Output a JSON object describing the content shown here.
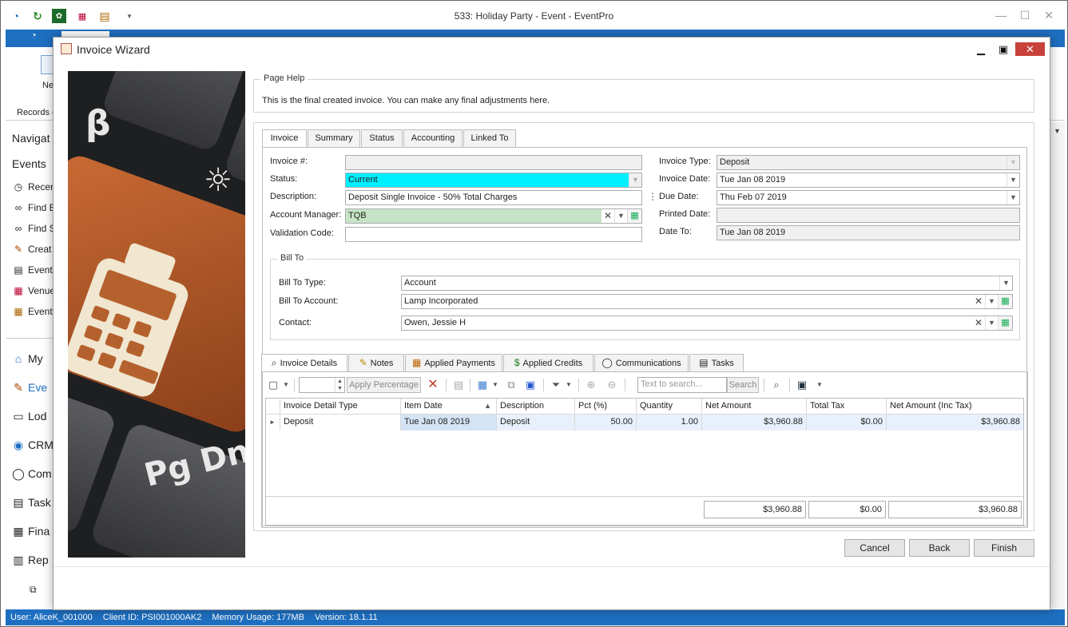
{
  "app": {
    "title": "533: Holiday Party - Event - EventPro",
    "ribbon": {
      "new_label": "Ne",
      "records_label": "Records ("
    },
    "nav": {
      "header": "Navigat",
      "events_header": "Events",
      "items": [
        "Recen",
        "Find E",
        "Find S",
        "Creat",
        "Event",
        "Venue",
        "Event"
      ],
      "modules": [
        "My",
        "Eve",
        "Lod",
        "CRM",
        "Com",
        "Task",
        "Fina",
        "Rep"
      ]
    },
    "status": {
      "user": "User: AliceK_001000",
      "client": "Client ID: PSI001000AK2",
      "memory": "Memory Usage: 177MB",
      "version": "Version: 18.1.11"
    }
  },
  "dialog": {
    "title": "Invoice Wizard",
    "page_help": {
      "legend": "Page Help",
      "text": "This is the final created invoice.  You can make any final adjustments here."
    },
    "tabs": [
      "Invoice",
      "Summary",
      "Status",
      "Accounting",
      "Linked To"
    ],
    "invoice": {
      "invoice_no_label": "Invoice #:",
      "invoice_no_value": "",
      "status_label": "Status:",
      "status_value": "Current",
      "description_label": "Description:",
      "description_value": "Deposit Single Invoice - 50% Total Charges",
      "account_manager_label": "Account Manager:",
      "account_manager_value": "TQB",
      "validation_code_label": "Validation Code:",
      "validation_code_value": "",
      "invoice_type_label": "Invoice Type:",
      "invoice_type_value": "Deposit",
      "invoice_date_label": "Invoice Date:",
      "invoice_date_value": "Tue Jan 08 2019",
      "due_date_label": "Due Date:",
      "due_date_value": "Thu Feb 07 2019",
      "printed_date_label": "Printed Date:",
      "printed_date_value": "",
      "date_to_label": "Date To:",
      "date_to_value": "Tue Jan 08 2019"
    },
    "bill_to": {
      "legend": "Bill To",
      "type_label": "Bill To Type:",
      "type_value": "Account",
      "account_label": "Bill To Account:",
      "account_value": "Lamp Incorporated",
      "contact_label": "Contact:",
      "contact_value": "Owen, Jessie H"
    },
    "detail_tabs": [
      "Invoice Details",
      "Notes",
      "Applied Payments",
      "Applied Credits",
      "Communications",
      "Tasks"
    ],
    "toolbar": {
      "apply_percentage": "Apply Percentage",
      "search_placeholder": "Text to search...",
      "search_button": "Search"
    },
    "grid": {
      "columns": [
        "Invoice Detail Type",
        "Item Date",
        "Description",
        "Pct (%)",
        "Quantity",
        "Net Amount",
        "Total Tax",
        "Net Amount (Inc Tax)"
      ],
      "rows": [
        [
          "Deposit",
          "Tue Jan 08 2019",
          "Deposit",
          "50.00",
          "1.00",
          "$3,960.88",
          "$0.00",
          "$3,960.88"
        ]
      ],
      "totals": {
        "net_amount": "$3,960.88",
        "total_tax": "$0.00",
        "net_inc_tax": "$3,960.88"
      }
    },
    "buttons": {
      "cancel": "Cancel",
      "back": "Back",
      "finish": "Finish"
    }
  },
  "colors": {
    "status_highlight": "#00f0ff",
    "account_manager_highlight": "#c6e4c6",
    "brand_blue": "#1e6fc1",
    "close_red": "#c8413a"
  }
}
